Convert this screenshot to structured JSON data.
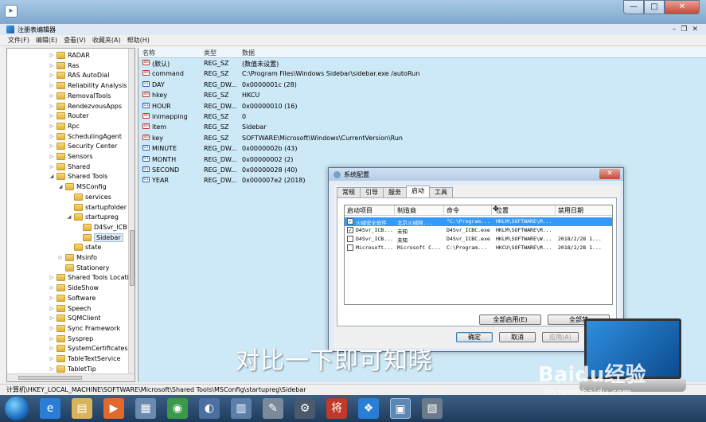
{
  "regedit": {
    "title": "注册表编辑器",
    "menu": [
      "文件(F)",
      "编辑(E)",
      "查看(V)",
      "收藏夹(A)",
      "帮助(H)"
    ],
    "tree": [
      "RADAR",
      "Ras",
      "RAS AutoDial",
      "Reliability Analysis",
      "RemovalTools",
      "RendezvousApps",
      "Router",
      "Rpc",
      "SchedulingAgent",
      "Security Center",
      "Sensors",
      "Shared",
      "Shared Tools",
      "MSConfig",
      "services",
      "startupfolder",
      "startupreg",
      "D4Svr_ICB",
      "Sidebar",
      "state",
      "Msinfo",
      "Stationery",
      "Shared Tools Locati",
      "SideShow",
      "Software",
      "Speech",
      "SQMClient",
      "Sync Framework",
      "Sysprep",
      "SystemCertificates",
      "TableTextService",
      "TabletTip"
    ],
    "columns": {
      "name": "名称",
      "type": "类型",
      "data": "数据"
    },
    "values": [
      {
        "name": "(默认)",
        "type": "REG_SZ",
        "data": "(数值未设置)",
        "kind": "sz"
      },
      {
        "name": "command",
        "type": "REG_SZ",
        "data": "C:\\Program Files\\Windows Sidebar\\sidebar.exe /autoRun",
        "kind": "sz"
      },
      {
        "name": "DAY",
        "type": "REG_DW...",
        "data": "0x0000001c (28)",
        "kind": "dw"
      },
      {
        "name": "hkey",
        "type": "REG_SZ",
        "data": "HKCU",
        "kind": "sz"
      },
      {
        "name": "HOUR",
        "type": "REG_DW...",
        "data": "0x00000010 (16)",
        "kind": "dw"
      },
      {
        "name": "inimapping",
        "type": "REG_SZ",
        "data": "0",
        "kind": "sz"
      },
      {
        "name": "item",
        "type": "REG_SZ",
        "data": "Sidebar",
        "kind": "sz"
      },
      {
        "name": "key",
        "type": "REG_SZ",
        "data": "SOFTWARE\\Microsoft\\Windows\\CurrentVersion\\Run",
        "kind": "sz"
      },
      {
        "name": "MINUTE",
        "type": "REG_DW...",
        "data": "0x0000002b (43)",
        "kind": "dw"
      },
      {
        "name": "MONTH",
        "type": "REG_DW...",
        "data": "0x00000002 (2)",
        "kind": "dw"
      },
      {
        "name": "SECOND",
        "type": "REG_DW...",
        "data": "0x00000028 (40)",
        "kind": "dw"
      },
      {
        "name": "YEAR",
        "type": "REG_DW...",
        "data": "0x000007e2 (2018)",
        "kind": "dw"
      }
    ],
    "status_path": "计算机\\HKEY_LOCAL_MACHINE\\SOFTWARE\\Microsoft\\Shared Tools\\MSConfig\\startupreg\\Sidebar"
  },
  "dialog": {
    "title": "系统配置",
    "tabs": [
      "常规",
      "引导",
      "服务",
      "启动",
      "工具"
    ],
    "active_tab": "启动",
    "columns": {
      "item": "启动项目",
      "maker": "制造商",
      "command": "命令",
      "location": "位置",
      "disabled_date": "禁用日期"
    },
    "rows": [
      {
        "checked": true,
        "item": "火绒安全软件",
        "maker": "北京火绒网...",
        "command": "\"C:\\Program...",
        "location": "HKLM\\SOFTWARE\\M...",
        "disabled_date": ""
      },
      {
        "checked": true,
        "item": "D4Svr_ICB...",
        "maker": "未知",
        "command": "D4Svr_ICBC.exe",
        "location": "HKLM\\SOFTWARE\\M...",
        "disabled_date": ""
      },
      {
        "checked": false,
        "item": "D4Svr_ICB...",
        "maker": "未知",
        "command": "D4Svr_ICBC.exe",
        "location": "HKLM\\SOFTWARE\\W...",
        "disabled_date": "2018/2/28 1..."
      },
      {
        "checked": false,
        "item": "Microsoft...",
        "maker": "Microsoft C...",
        "command": "C:\\Program...",
        "location": "HKCU\\SOFTWARE\\M...",
        "disabled_date": "2018/2/28 1..."
      }
    ],
    "enable_all": "全部启用(E)",
    "disable_all": "全部禁",
    "ok": "确定",
    "cancel": "取消",
    "apply": "应用(A)"
  },
  "overlay": {
    "caption": "对比一下即可知晓",
    "watermark": "Baidu经验",
    "watermark_url": "jingyan.baidu.com"
  },
  "colors": {
    "selection": "#3399ff",
    "values_bg": "#cde8f6",
    "taskbar": "#1f3b5c"
  }
}
